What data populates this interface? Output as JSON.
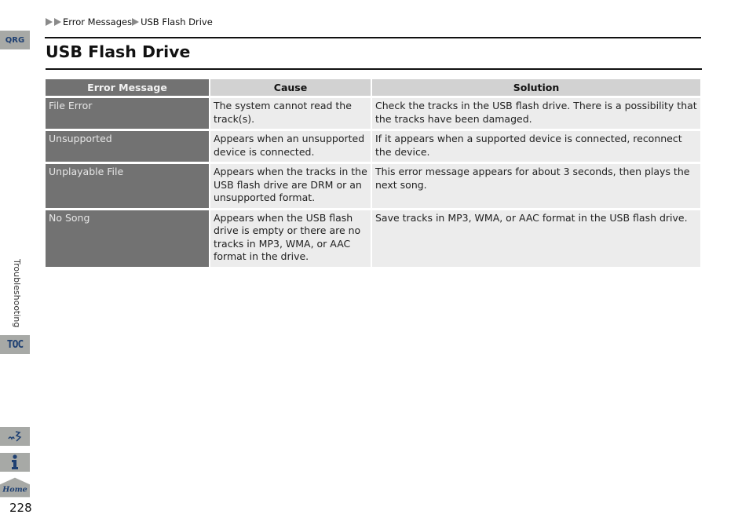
{
  "side_tabs": {
    "qrg": "QRG",
    "toc": "TOC",
    "home": "Home"
  },
  "section_label": "Troubleshooting",
  "page_number": "228",
  "breadcrumb": [
    "Error Messages",
    "USB Flash Drive"
  ],
  "title": "USB Flash Drive",
  "table": {
    "headers": [
      "Error Message",
      "Cause",
      "Solution"
    ],
    "rows": [
      {
        "message": "File Error",
        "cause": "The system cannot read the track(s).",
        "solution": "Check the tracks in the USB flash drive. There is a possibility that the tracks have been damaged."
      },
      {
        "message": "Unsupported",
        "cause": "Appears when an unsupported device is connected.",
        "solution": "If it appears when a supported device is connected, reconnect the device."
      },
      {
        "message": "Unplayable File",
        "cause": "Appears when the tracks in the USB flash drive are DRM or an unsupported format.",
        "solution": "This error message appears for about 3 seconds, then plays the next song."
      },
      {
        "message": "No Song",
        "cause": "Appears when the USB flash drive is empty or there are no tracks in MP3, WMA, or AAC format in the drive.",
        "solution": "Save tracks in MP3, WMA, or AAC format in the USB flash drive."
      }
    ]
  }
}
